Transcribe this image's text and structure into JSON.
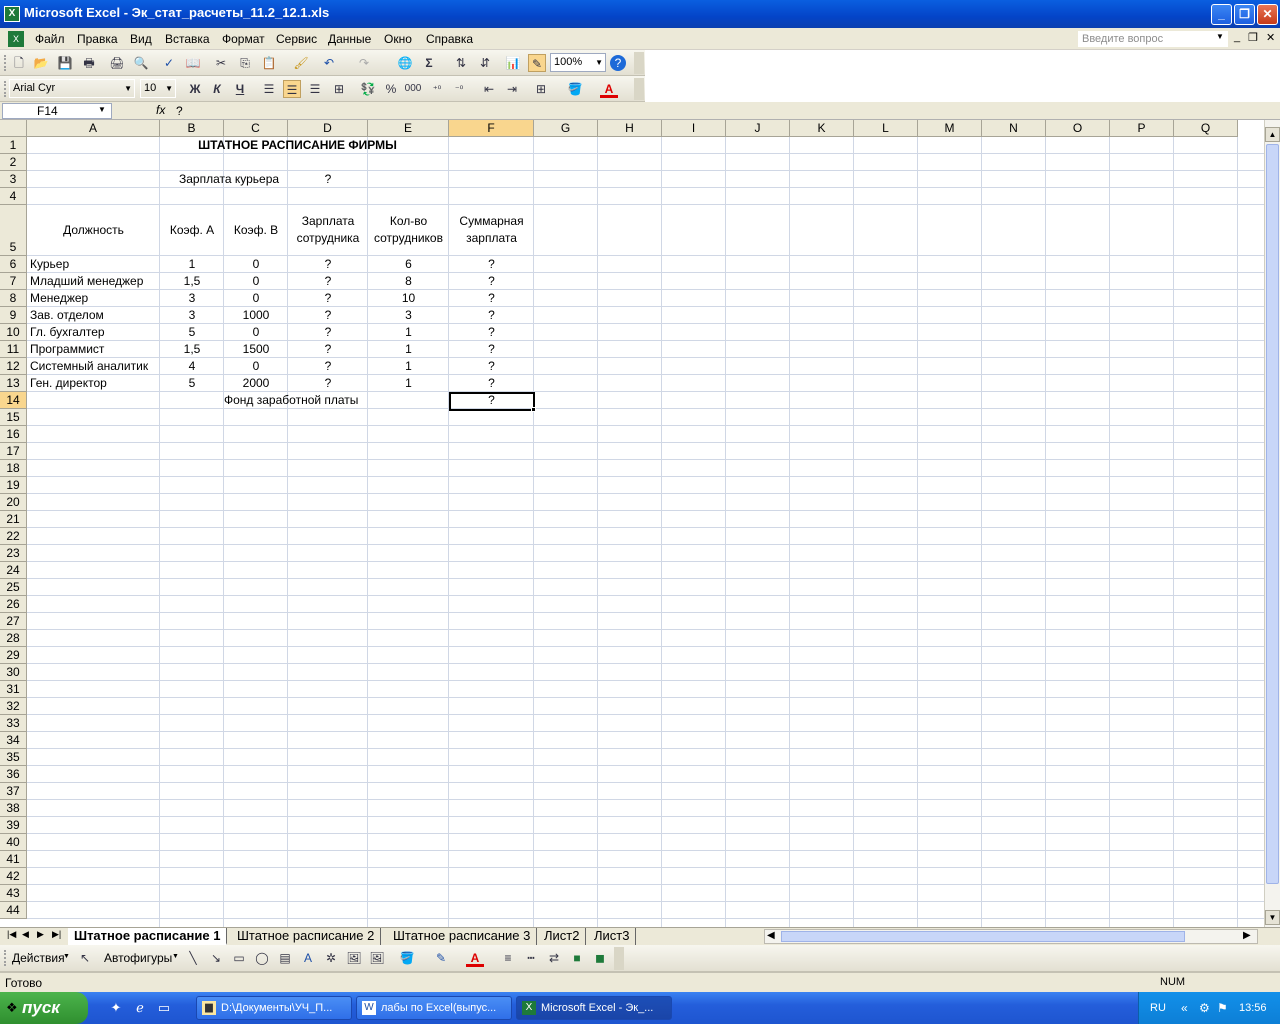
{
  "window": {
    "title": "Microsoft Excel - Эк_стат_расчеты_11.2_12.1.xls"
  },
  "menu": {
    "items": [
      "Файл",
      "Правка",
      "Вид",
      "Вставка",
      "Формат",
      "Сервис",
      "Данные",
      "Окно",
      "Справка"
    ],
    "help_placeholder": "Введите вопрос"
  },
  "toolbar": {
    "zoom": "100%",
    "font": "Arial Cyr",
    "size": "10",
    "bold": "Ж",
    "italic": "К",
    "underline": "Ч",
    "percent": "%",
    "thousands": "000",
    "sum": "Σ"
  },
  "formula_bar": {
    "name_box": "F14",
    "fx": "fx",
    "content": "?"
  },
  "columns": [
    "A",
    "B",
    "C",
    "D",
    "E",
    "F",
    "G",
    "H",
    "I",
    "J",
    "K",
    "L",
    "M",
    "N",
    "O",
    "P",
    "Q"
  ],
  "selected_col": "F",
  "selected_row": "14",
  "cells": {
    "title": "ШТАТНОЕ РАСПИСАНИЕ ФИРМЫ",
    "courier_salary_label": "Зарплата курьера",
    "courier_salary_value": "?",
    "headers": {
      "position": "Должность",
      "coef_a": "Коэф. А",
      "coef_b": "Коэф. В",
      "salary_l1": "Зарплата",
      "salary_l2": "сотрудника",
      "count_l1": "Кол-во",
      "count_l2": "сотрудников",
      "total_l1": "Суммарная",
      "total_l2": "зарплата"
    },
    "rows": [
      {
        "name": "Курьер",
        "a": "1",
        "b": "0",
        "d": "?",
        "e": "6",
        "f": "?"
      },
      {
        "name": "Младший менеджер",
        "a": "1,5",
        "b": "0",
        "d": "?",
        "e": "8",
        "f": "?"
      },
      {
        "name": "Менеджер",
        "a": "3",
        "b": "0",
        "d": "?",
        "e": "10",
        "f": "?"
      },
      {
        "name": "Зав. отделом",
        "a": "3",
        "b": "1000",
        "d": "?",
        "e": "3",
        "f": "?"
      },
      {
        "name": "Гл. бухгалтер",
        "a": "5",
        "b": "0",
        "d": "?",
        "e": "1",
        "f": "?"
      },
      {
        "name": "Программист",
        "a": "1,5",
        "b": "1500",
        "d": "?",
        "e": "1",
        "f": "?"
      },
      {
        "name": "Системный аналитик",
        "a": "4",
        "b": "0",
        "d": "?",
        "e": "1",
        "f": "?"
      },
      {
        "name": "Ген. директор",
        "a": "5",
        "b": "2000",
        "d": "?",
        "e": "1",
        "f": "?"
      }
    ],
    "fund_label": "Фонд заработной платы",
    "fund_value": "?"
  },
  "sheet_tabs": [
    "Штатное расписание 1",
    "Штатное расписание 2",
    "Штатное расписание 3",
    "Лист2",
    "Лист3"
  ],
  "active_tab": "Штатное расписание 1",
  "drawing": {
    "actions": "Действия",
    "autoshapes": "Автофигуры"
  },
  "status": {
    "left": "Готово",
    "num": "NUM"
  },
  "taskbar": {
    "start": "пуск",
    "tasks": [
      "D:\\Документы\\УЧ_П...",
      "лабы по Excel(выпус...",
      "Microsoft Excel - Эк_..."
    ],
    "lang": "RU",
    "clock": "13:56"
  }
}
